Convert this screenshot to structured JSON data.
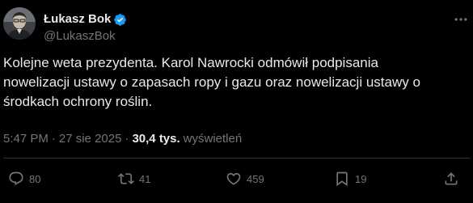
{
  "author": {
    "display_name": "Łukasz Bok",
    "handle": "@LukaszBok",
    "verified": true,
    "verified_color": "#1d9bf0"
  },
  "tweet": {
    "text": "Kolejne weta prezydenta. Karol Nawrocki odmówił podpisania\nnowelizacji ustawy o zapasach ropy i gazu oraz nowelizacji ustawy o\nśrodkach ochrony roślin."
  },
  "meta": {
    "time": "5:47 PM",
    "separator": "·",
    "date": "27 sie 2025",
    "views_count": "30,4 tys.",
    "views_label": "wyświetleń"
  },
  "actions": {
    "replies": "80",
    "reposts": "41",
    "likes": "459",
    "bookmarks": "19"
  },
  "icons": {
    "avatar": "avatar-photo",
    "verified": "verified-badge-icon",
    "more": "more-options-icon",
    "reply": "reply-icon",
    "repost": "repost-icon",
    "like": "heart-icon",
    "bookmark": "bookmark-icon",
    "share": "share-icon"
  },
  "colors": {
    "background": "#000000",
    "text_primary": "#e7e9ea",
    "text_secondary": "#71767b",
    "divider": "#2f3336"
  }
}
